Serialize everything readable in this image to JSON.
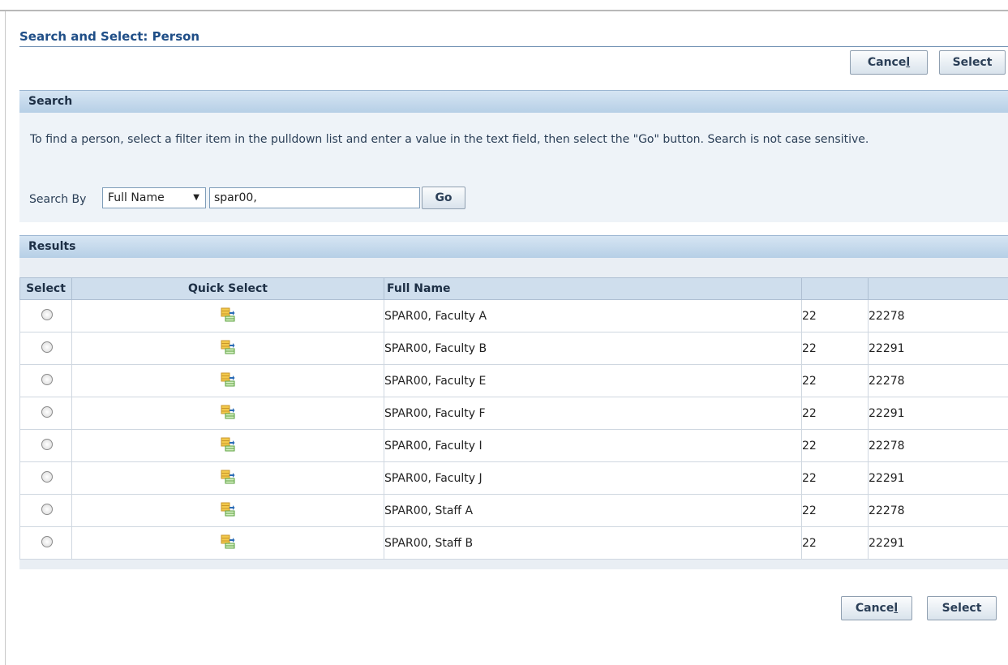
{
  "page_title": "Search and Select: Person",
  "top_buttons": {
    "cancel": "Cancel",
    "select": "Select"
  },
  "search": {
    "header": "Search",
    "instructions": "To find a person, select a filter item in the pulldown list and enter a value in the text field, then select the \"Go\" button. Search is not case sensitive.",
    "search_by_label": "Search By",
    "filter_value": "Full Name",
    "text_value": "spar00,",
    "go_label": "Go"
  },
  "results": {
    "header": "Results",
    "columns": [
      "Select",
      "Quick Select",
      "Full Name",
      "",
      ""
    ],
    "rows": [
      {
        "full_name": "SPAR00, Faculty A",
        "col4": "22",
        "col5": "22278"
      },
      {
        "full_name": "SPAR00, Faculty B",
        "col4": "22",
        "col5": "22291"
      },
      {
        "full_name": "SPAR00, Faculty E",
        "col4": "22",
        "col5": "22278"
      },
      {
        "full_name": "SPAR00, Faculty F",
        "col4": "22",
        "col5": "22291"
      },
      {
        "full_name": "SPAR00, Faculty I",
        "col4": "22",
        "col5": "22278"
      },
      {
        "full_name": "SPAR00, Faculty J",
        "col4": "22",
        "col5": "22291"
      },
      {
        "full_name": "SPAR00, Staff A",
        "col4": "22",
        "col5": "22278"
      },
      {
        "full_name": "SPAR00, Staff B",
        "col4": "22",
        "col5": "22291"
      }
    ]
  },
  "bottom_buttons": {
    "cancel": "Cancel",
    "select": "Select"
  },
  "icons": {
    "quick_select": "quick-select-icon",
    "dropdown": "chevron-down-icon"
  },
  "colors": {
    "title": "#1f4e87",
    "header_bg": "#c3d7ea",
    "panel_bg": "#eef3f8"
  }
}
